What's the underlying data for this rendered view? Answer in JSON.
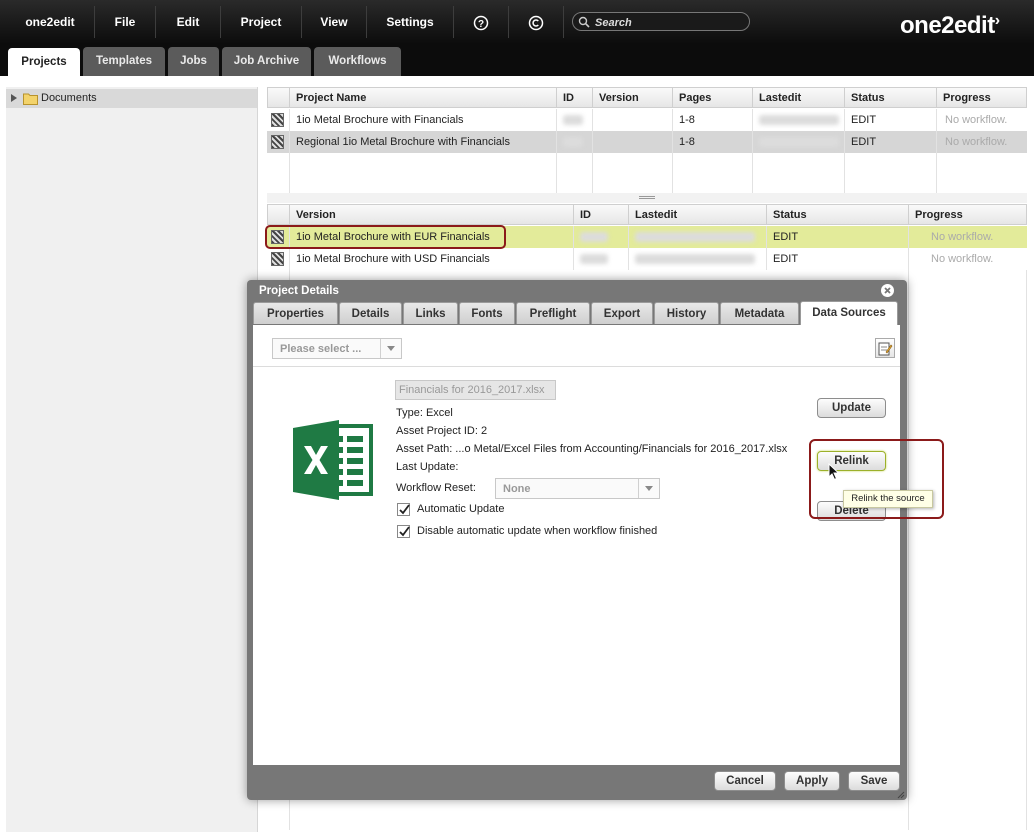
{
  "menubar": {
    "brand": "one2edit",
    "items": [
      "File",
      "Edit",
      "Project",
      "View",
      "Settings"
    ],
    "search_placeholder": "Search",
    "logo": "one2edit"
  },
  "tabs": [
    "Projects",
    "Templates",
    "Jobs",
    "Job Archive",
    "Workflows"
  ],
  "tree": {
    "root": "Documents"
  },
  "projects_grid": {
    "headers": [
      "Project Name",
      "ID",
      "Version",
      "Pages",
      "Lastedit",
      "Status",
      "Progress"
    ],
    "rows": [
      {
        "name": "1io Metal Brochure with Financials",
        "pages": "1-8",
        "status": "EDIT",
        "progress": "No workflow."
      },
      {
        "name": "Regional 1io Metal Brochure with Financials",
        "pages": "1-8",
        "status": "EDIT",
        "progress": "No workflow."
      }
    ]
  },
  "versions_grid": {
    "headers": [
      "Version",
      "ID",
      "Lastedit",
      "Status",
      "Progress"
    ],
    "rows": [
      {
        "name": "1io Metal Brochure with EUR Financials",
        "status": "EDIT",
        "progress": "No workflow."
      },
      {
        "name": "1io Metal Brochure with USD Financials",
        "status": "EDIT",
        "progress": "No workflow."
      }
    ]
  },
  "dialog": {
    "title": "Project Details",
    "tabs": [
      "Properties",
      "Details",
      "Links",
      "Fonts",
      "Preflight",
      "Export",
      "History",
      "Metadata",
      "Data Sources"
    ],
    "select_placeholder": "Please select ...",
    "file_name": "Financials for 2016_2017.xlsx",
    "type": "Type: Excel",
    "asset_project_id": "Asset Project ID: 2",
    "asset_path": "Asset Path: ...o Metal/Excel Files from Accounting/Financials for 2016_2017.xlsx",
    "last_update": "Last Update:",
    "workflow_reset_label": "Workflow Reset:",
    "workflow_reset_value": "None",
    "automatic_update": "Automatic Update",
    "disable_auto_update": "Disable automatic update when workflow finished",
    "buttons": {
      "update": "Update",
      "relink": "Relink",
      "delete": "Delete",
      "cancel": "Cancel",
      "apply": "Apply",
      "save": "Save"
    },
    "tooltip": "Relink the source"
  },
  "colors": {
    "highlight_row": "#e3eb9a",
    "callout": "#8b1a1a",
    "excel": "#1f7a44"
  }
}
